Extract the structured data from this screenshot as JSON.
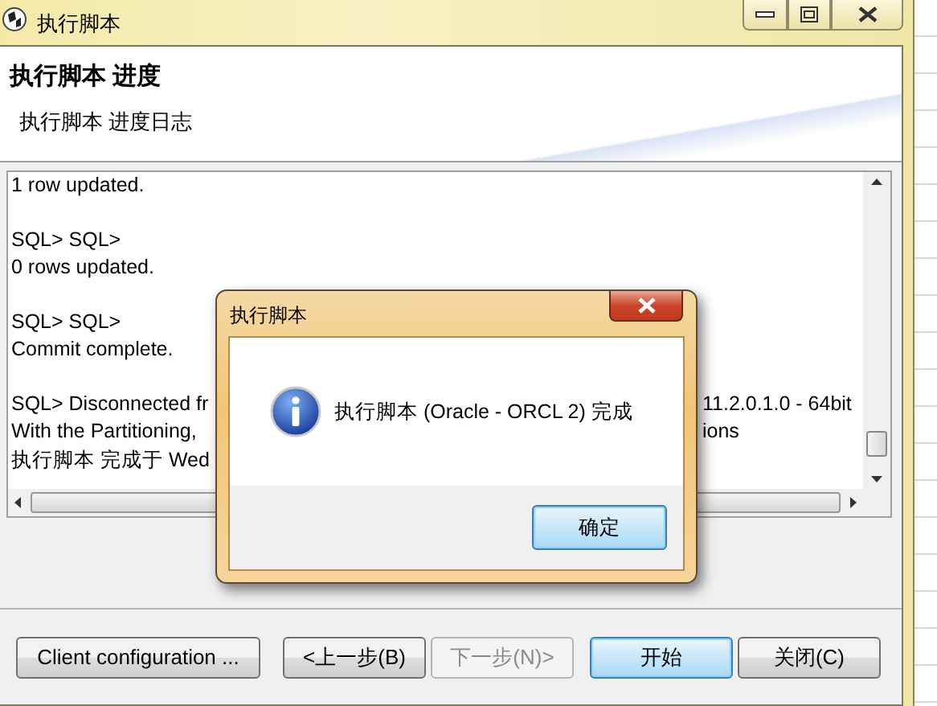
{
  "window": {
    "title": "执行脚本"
  },
  "header": {
    "title": "执行脚本 进度",
    "subtitle": "执行脚本 进度日志"
  },
  "log": {
    "lines": [
      {
        "kind": "text",
        "text": "1 row updated."
      },
      {
        "kind": "blank"
      },
      {
        "kind": "text",
        "text": "SQL> SQL>"
      },
      {
        "kind": "text",
        "text": "0 rows updated."
      },
      {
        "kind": "blank"
      },
      {
        "kind": "text",
        "text": "SQL> SQL>"
      },
      {
        "kind": "text",
        "text": "Commit complete."
      },
      {
        "kind": "blank"
      },
      {
        "kind": "split",
        "text": "SQL> Disconnected fr",
        "right": "11.2.0.1.0 - 64bit"
      },
      {
        "kind": "split",
        "text": "With the Partitioning,",
        "right": "ions"
      },
      {
        "kind": "text",
        "text": "执行脚本 完成于 Wed"
      }
    ]
  },
  "extra_buttons": [
    {
      "label": "Client configuration ...",
      "disabled": false,
      "default": false
    }
  ],
  "buttons": [
    {
      "label": "<上一步(B)",
      "disabled": false,
      "default": false
    },
    {
      "label": "下一步(N)>",
      "disabled": true,
      "default": false
    },
    {
      "label": "开始",
      "disabled": false,
      "default": true
    },
    {
      "label": "关闭(C)",
      "disabled": false,
      "default": false
    }
  ],
  "dialog": {
    "title": "执行脚本",
    "message": "执行脚本 (Oracle - ORCL 2) 完成",
    "ok_button": "确定"
  }
}
